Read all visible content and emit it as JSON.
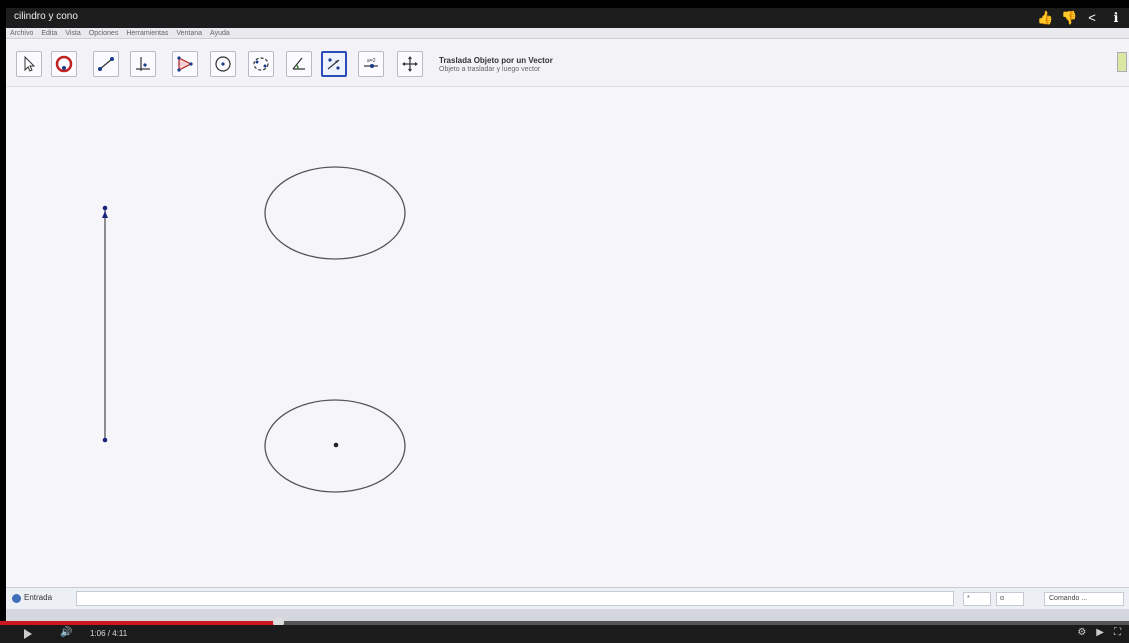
{
  "window": {
    "title": "cilindro y cono"
  },
  "top_icons": [
    {
      "name": "like-icon",
      "glyph": "👍"
    },
    {
      "name": "dislike-icon",
      "glyph": "👎"
    },
    {
      "name": "share-icon",
      "glyph": "<"
    },
    {
      "name": "info-icon",
      "glyph": "ℹ"
    }
  ],
  "menu": [
    "Archivo",
    "Edita",
    "Vista",
    "Opciones",
    "Herramientas",
    "Ventana",
    "Ayuda"
  ],
  "toolbar": {
    "tools": [
      {
        "name": "move-tool"
      },
      {
        "name": "point-tool"
      },
      {
        "name": "line-tool"
      },
      {
        "name": "perpendicular-tool"
      },
      {
        "name": "polygon-tool"
      },
      {
        "name": "circle-tool"
      },
      {
        "name": "conic-tool"
      },
      {
        "name": "angle-tool"
      },
      {
        "name": "translate-vector-tool",
        "active": true
      },
      {
        "name": "slider-tool"
      },
      {
        "name": "move-view-tool"
      }
    ],
    "active_tool_name": "Traslada Objeto por un Vector",
    "active_tool_desc": "Objeto a trasladar y luego vector"
  },
  "input_bar": {
    "label": "Entrada",
    "value": "",
    "sym1": "*",
    "sym2": "α",
    "command": "Comando ..."
  },
  "player": {
    "time": "1:06 / 4:11",
    "progress": 0.25
  }
}
